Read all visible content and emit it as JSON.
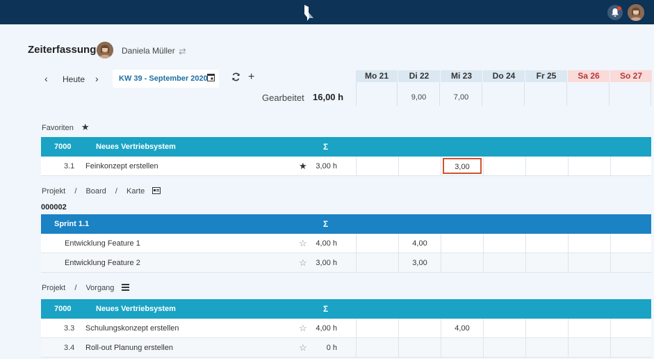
{
  "header": {
    "notification_badge_color": "#e0452d"
  },
  "page": {
    "title": "Zeiterfassung",
    "user_name": "Daniela Müller"
  },
  "toolbar": {
    "today_label": "Heute",
    "week_label": "KW 39 - September 2020",
    "worked_label": "Gearbeitet",
    "worked_value": "16,00 h"
  },
  "days": [
    {
      "label": "Mo 21",
      "sum": ""
    },
    {
      "label": "Di 22",
      "sum": "9,00"
    },
    {
      "label": "Mi 23",
      "sum": "7,00"
    },
    {
      "label": "Do 24",
      "sum": ""
    },
    {
      "label": "Fr 25",
      "sum": ""
    },
    {
      "label": "Sa 26",
      "sum": ""
    },
    {
      "label": "So 27",
      "sum": ""
    }
  ],
  "sections": {
    "favorites": {
      "label": "Favoriten",
      "group": {
        "id": "7000",
        "name": "Neues Vertriebsystem",
        "sigma": "Σ"
      },
      "rows": [
        {
          "num": "3.1",
          "name": "Feinkonzept erstellen",
          "total": "3,00 h",
          "favorite": true,
          "cells": [
            "",
            "",
            "3,00",
            "",
            "",
            "",
            ""
          ]
        }
      ]
    },
    "board": {
      "breadcrumb": [
        "Projekt",
        "/",
        "Board",
        "/",
        "Karte"
      ],
      "id": "000002",
      "group": {
        "name": "Sprint 1.1",
        "sigma": "Σ"
      },
      "rows": [
        {
          "name": "Entwicklung Feature 1",
          "total": "4,00 h",
          "favorite": false,
          "cells": [
            "",
            "4,00",
            "",
            "",
            "",
            "",
            ""
          ]
        },
        {
          "name": "Entwicklung Feature 2",
          "total": "3,00 h",
          "favorite": false,
          "cells": [
            "",
            "3,00",
            "",
            "",
            "",
            "",
            ""
          ]
        }
      ]
    },
    "process": {
      "breadcrumb": [
        "Projekt",
        "/",
        "Vorgang"
      ],
      "group": {
        "id": "7000",
        "name": "Neues Vertriebsystem",
        "sigma": "Σ"
      },
      "rows": [
        {
          "num": "3.3",
          "name": "Schulungskonzept erstellen",
          "total": "4,00 h",
          "favorite": false,
          "cells": [
            "",
            "",
            "4,00",
            "",
            "",
            "",
            ""
          ]
        },
        {
          "num": "3.4",
          "name": "Roll-out Planung erstellen",
          "total": "0 h",
          "favorite": false,
          "cells": [
            "",
            "",
            "",
            "",
            "",
            "",
            ""
          ]
        }
      ]
    }
  }
}
